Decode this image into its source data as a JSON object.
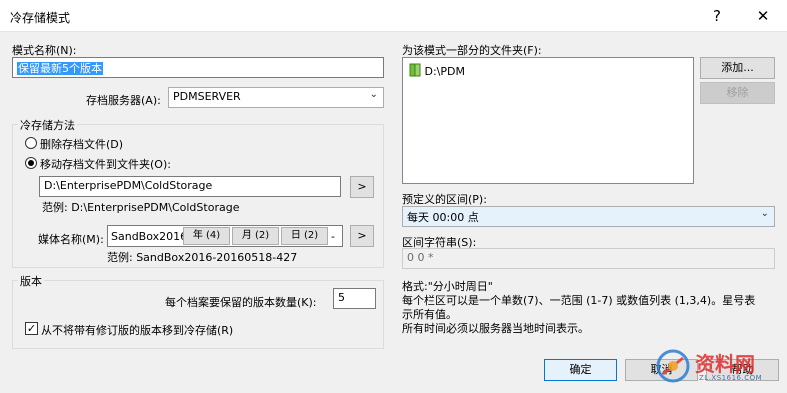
{
  "dialog": {
    "title": "冷存储模式",
    "help_label": "?",
    "close_label": "✕"
  },
  "template_name": {
    "label": "模式名称(N):",
    "value": "保留最新5个版本"
  },
  "archive_server": {
    "label": "存档服务器(A):",
    "value": "PDMSERVER"
  },
  "cold_storage_method": {
    "group_label": "冷存储方法",
    "delete_option": "删除存档文件(D)",
    "move_option": "移动存档文件到文件夹(O):",
    "folder_path": "D:\\EnterprisePDM\\ColdStorage",
    "browse_label": ">",
    "example_label": "范例: D:\\EnterprisePDM\\ColdStorage",
    "media_label": "媒体名称(M):",
    "media_prefix": "SandBox2016-",
    "media_tokens": [
      "年 (4)",
      "月 (2)",
      "日 (2)"
    ],
    "media_more": "-",
    "media_browse_label": ">",
    "media_example": "范例: SandBox2016-20160518-427"
  },
  "version": {
    "group_label": "版本",
    "keep_label": "每个档案要保留的版本数量(K):",
    "keep_value": "5",
    "skip_label": "从不将带有修订版的版本移到冷存储(R)",
    "skip_checked": true
  },
  "folders": {
    "label": "为该模式一部分的文件夹(F):",
    "items": [
      "D:\\PDM"
    ],
    "add_label": "添加...",
    "remove_label": "移除"
  },
  "schedule": {
    "label": "预定义的区间(P):",
    "value": "每天 00:00 点",
    "string_label": "区间字符串(S):",
    "string_value": "0 0 *"
  },
  "format_help": {
    "line1": "格式:\"分小时周日\"",
    "line2": "每个栏区可以是一个单数(7)、一范围 (1-7) 或数值列表 (1,3,4)。星号表",
    "line3": "示所有值。",
    "line4": "所有时间必须以服务器当地时间表示。"
  },
  "footer": {
    "ok_label": "确定",
    "cancel_label": "取消",
    "help_label": "帮助"
  },
  "watermark": {
    "brand": "资料网",
    "url": "ZL.XS1616.COM"
  }
}
